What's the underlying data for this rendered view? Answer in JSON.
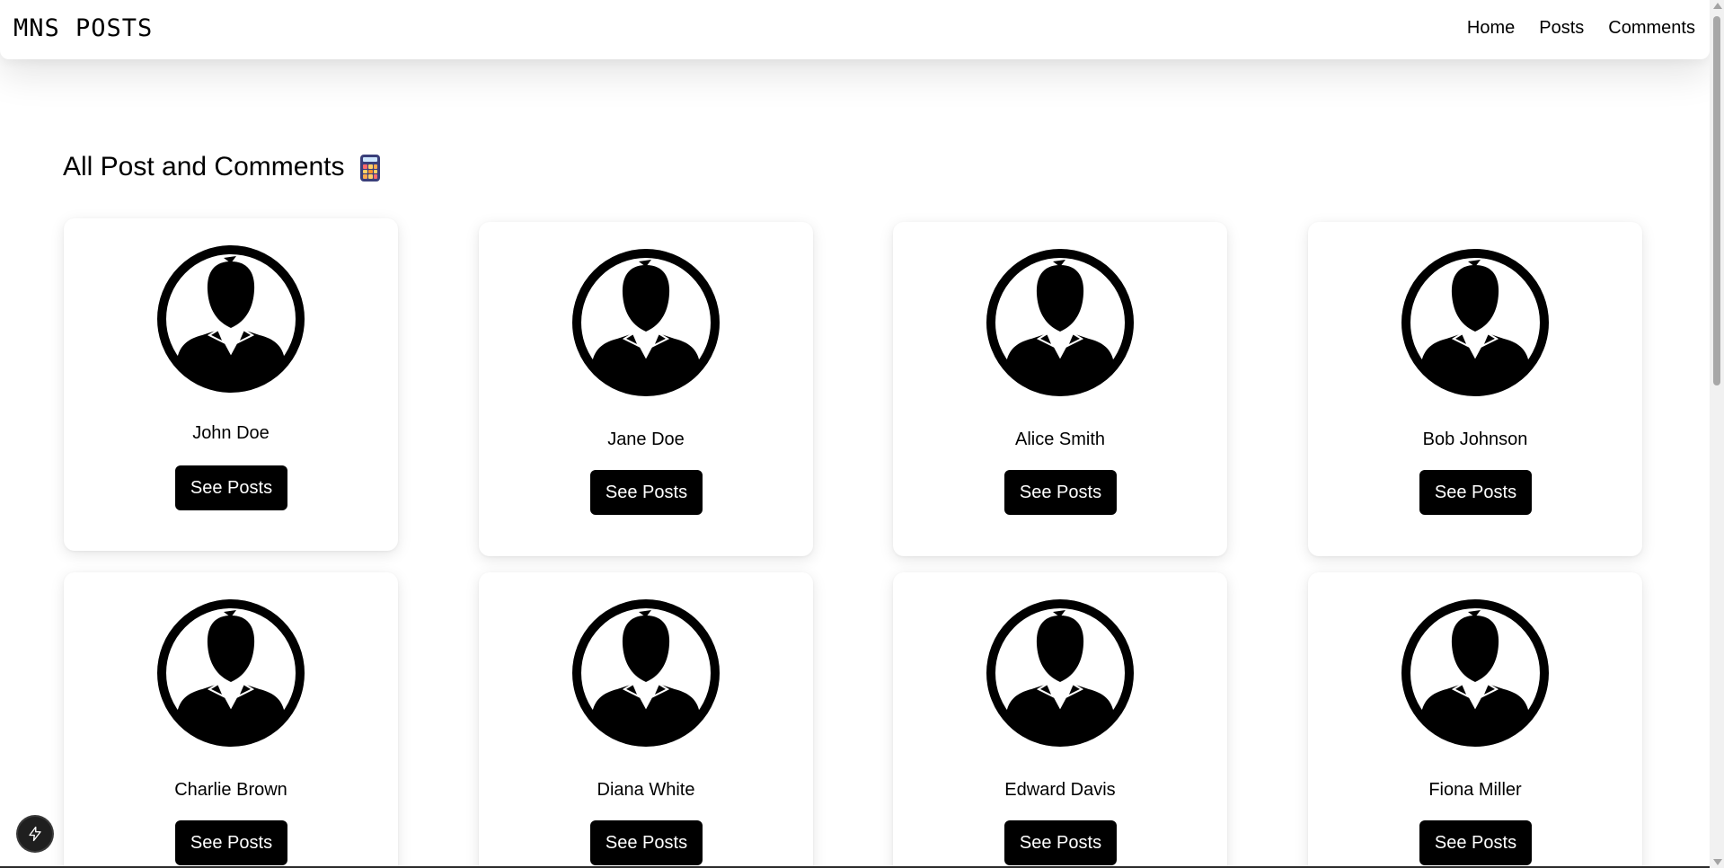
{
  "header": {
    "brand": "MNS POSTS",
    "nav": [
      "Home",
      "Posts",
      "Comments"
    ]
  },
  "main": {
    "title": "All Post and Comments",
    "title_icon": "calculator-icon",
    "button_label": "See Posts",
    "users": [
      {
        "name": "John Doe"
      },
      {
        "name": "Jane Doe"
      },
      {
        "name": "Alice Smith"
      },
      {
        "name": "Bob Johnson"
      },
      {
        "name": "Charlie Brown"
      },
      {
        "name": "Diana White"
      },
      {
        "name": "Edward Davis"
      },
      {
        "name": "Fiona Miller"
      }
    ]
  },
  "icons": {
    "avatar": "user-avatar-icon",
    "dev_badge": "lightning-icon"
  },
  "colors": {
    "button_bg": "#000000",
    "button_text": "#ffffff",
    "page_bg": "#ffffff"
  }
}
